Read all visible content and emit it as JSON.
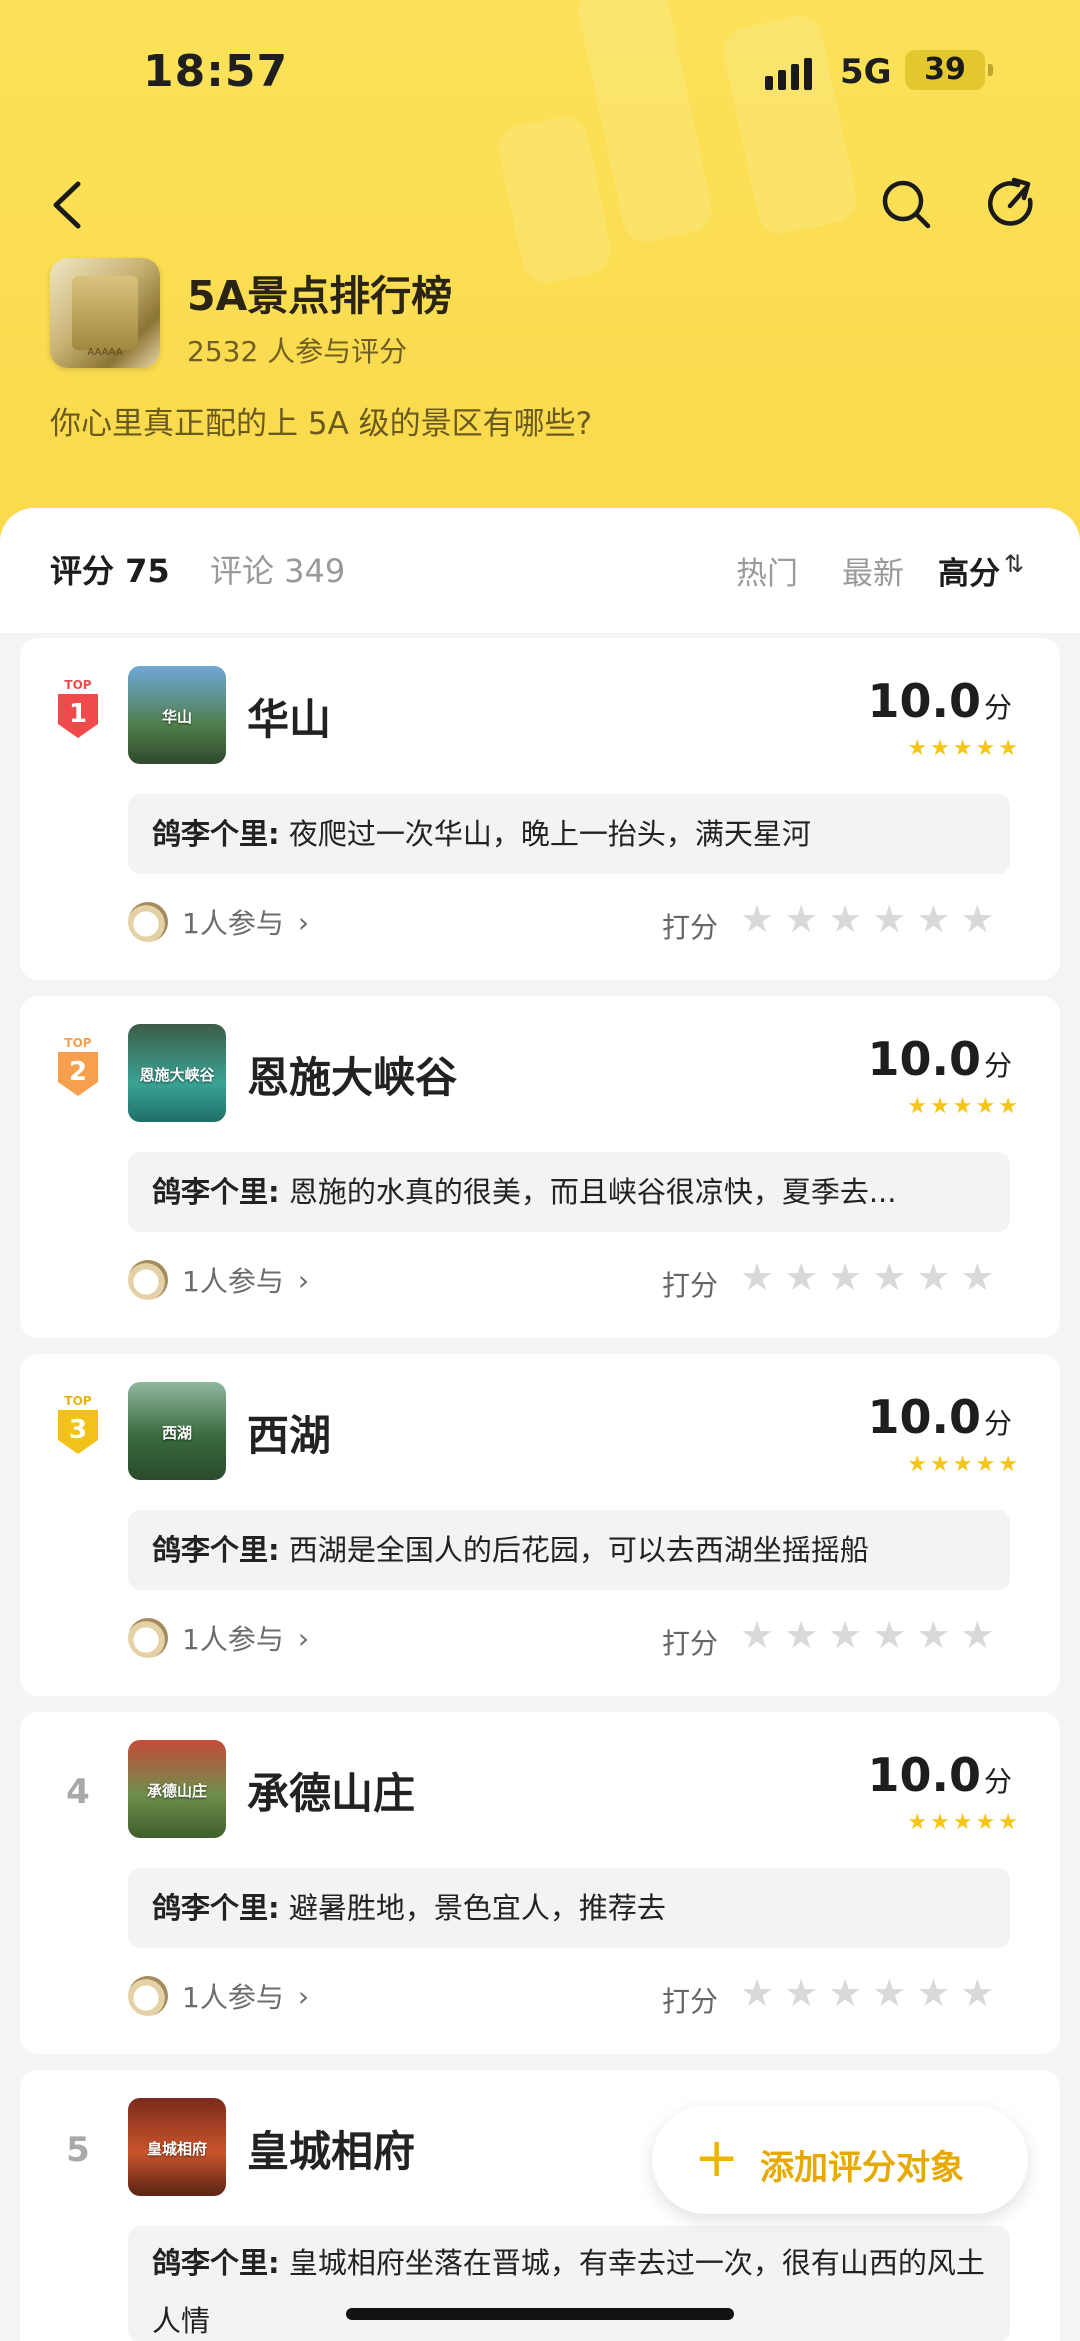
{
  "status": {
    "time": "18:57",
    "network": "5G",
    "battery": "39"
  },
  "header": {
    "title": "5A景点排行榜",
    "participants": "2532 人参与评分",
    "question": "你心里真正配的上 5A 级的景区有哪些?"
  },
  "tabs": {
    "score": "评分 75",
    "comments": "评论 349"
  },
  "sort": {
    "hot": "热门",
    "latest": "最新",
    "high": "高分",
    "high_icon": "⇅"
  },
  "items": [
    {
      "rank": "1",
      "name": "华山",
      "thumb_label": "华山",
      "score": "10.0",
      "unit": "分",
      "user": "鸽李个里:",
      "comment": "夜爬过一次华山，晚上一抬头，满天星河",
      "participants": "1人参与",
      "rate_label": "打分"
    },
    {
      "rank": "2",
      "name": "恩施大峡谷",
      "thumb_label": "恩施大峡谷",
      "score": "10.0",
      "unit": "分",
      "user": "鸽李个里:",
      "comment": "恩施的水真的很美，而且峡谷很凉快，夏季去...",
      "participants": "1人参与",
      "rate_label": "打分"
    },
    {
      "rank": "3",
      "name": "西湖",
      "thumb_label": "西湖",
      "score": "10.0",
      "unit": "分",
      "user": "鸽李个里:",
      "comment": "西湖是全国人的后花园，可以去西湖坐摇摇船",
      "participants": "1人参与",
      "rate_label": "打分"
    },
    {
      "rank": "4",
      "name": "承德山庄",
      "thumb_label": "承德山庄",
      "score": "10.0",
      "unit": "分",
      "user": "鸽李个里:",
      "comment": "避暑胜地，景色宜人，推荐去",
      "participants": "1人参与",
      "rate_label": "打分"
    },
    {
      "rank": "5",
      "name": "皇城相府",
      "thumb_label": "皇城相府",
      "user": "鸽李个里:",
      "comment": "皇城相府坐落在晋城，有幸去过一次，很有山西的风土人情"
    }
  ],
  "top_badge_text": "TOP",
  "fab": {
    "label": "添加评分对象",
    "plus": "+"
  },
  "colors": {
    "header": "#fbdf54",
    "gold": "#f5c518",
    "top1": "#ef4b4b",
    "top2": "#f6a04d",
    "top3": "#f3c21a"
  }
}
